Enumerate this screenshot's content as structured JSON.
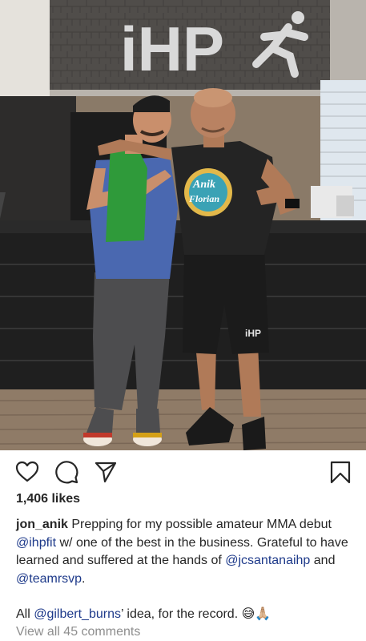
{
  "photo": {
    "sign_text": "iHP",
    "shirt_text": [
      "Anik",
      "Florian"
    ],
    "shorts_text": "iHP"
  },
  "actions": {
    "like_icon": "heart-icon",
    "comment_icon": "comment-icon",
    "share_icon": "send-icon",
    "save_icon": "bookmark-icon"
  },
  "likes": "1,406 likes",
  "caption": {
    "username": "jon_anik",
    "line1_a": " Prepping for my possible amateur MMA debut ",
    "mention_ihpfit": "@ihpfit",
    "line1_b": " w/ one of the best in the business. Grateful to have learned and suffered at the hands of ",
    "mention_jcsantana": "@jcsantanaihp",
    "and_text": " and ",
    "mention_teamrsvp": "@teamrsvp",
    "period": ".",
    "line2_a": "All ",
    "mention_gilbert": "@gilbert_burns",
    "line2_b": "’ idea, for the record. ",
    "emojis": "😅🙏🏼"
  },
  "view_comments": "View all 45 comments",
  "colors": {
    "text": "#262626",
    "mention": "#1e3a8a",
    "muted": "#8e8e8e"
  }
}
